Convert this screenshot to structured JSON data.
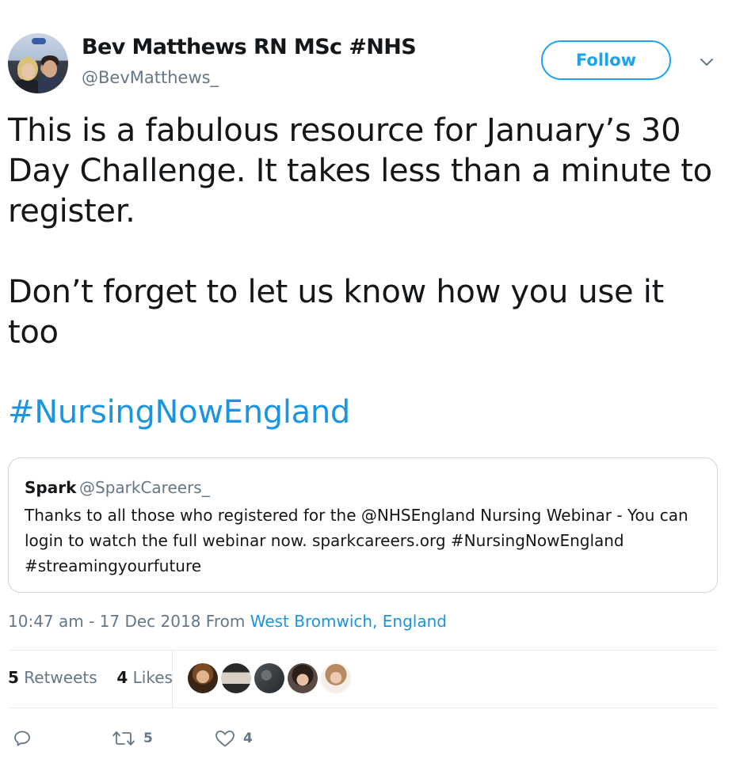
{
  "author": {
    "display_name": "Bev Matthews RN MSc #NHS",
    "handle": "@BevMatthews_"
  },
  "header": {
    "follow_label": "Follow",
    "menu_icon": "chevron-down-icon"
  },
  "tweet": {
    "text": "This is a fabulous resource for January’s 30\nDay Challenge. It takes less than a minute to\nregister.\n\nDon’t forget to let us know how you use it\ntoo",
    "hashtag": "#NursingNowEngland"
  },
  "quoted_tweet": {
    "name": "Spark",
    "handle": "@SparkCareers_",
    "text": "Thanks to all those who registered for the @NHSEngland Nursing Webinar - You can login to watch the full webinar now. sparkcareers.org #NursingNowEngland #streamingyourfuture"
  },
  "meta": {
    "time_date": "10:47 am - 17 Dec 2018",
    "from_label": "From",
    "location": "West Bromwich, England"
  },
  "stats": {
    "retweets_count": "5",
    "retweets_label": "Retweets",
    "likes_count": "4",
    "likes_label": "Likes"
  },
  "actions": {
    "reply_icon": "reply-icon",
    "retweet_icon": "retweet-icon",
    "retweet_count": "5",
    "like_icon": "heart-icon",
    "like_count": "4"
  },
  "colors": {
    "brand_blue": "#1da1f2",
    "link_blue": "#1b95e0",
    "muted_gray": "#657786"
  }
}
